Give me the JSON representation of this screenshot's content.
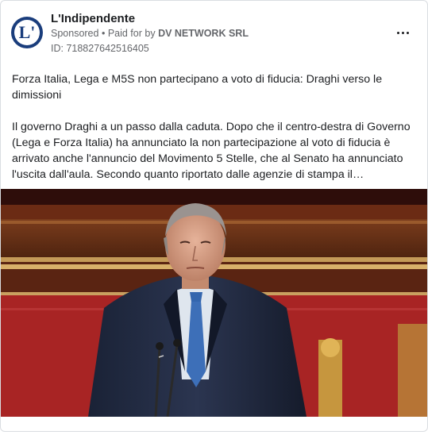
{
  "post": {
    "page_name": "L'Indipendente",
    "avatar_letter": "L'",
    "sponsored_label": "Sponsored",
    "paid_for_prefix": "Paid for by",
    "advertiser": "DV NETWORK SRL",
    "ad_id": "ID: 718827642516405",
    "headline": "Forza Italia, Lega e M5S non partecipano a voto di fiducia: Draghi verso le dimissioni",
    "body": "Il governo Draghi a un passo dalla caduta. Dopo che il centro-destra di Governo (Lega e Forza Italia) ha annunciato la non partecipazione al voto di fiducia è arrivato anche l'annuncio del Movimento 5 Stelle, che al Senato ha annunciato l'uscita dall'aula. Secondo quanto riportato dalle agenzie di stampa il presidente…",
    "more_icon": "more-horizontal-icon"
  },
  "colors": {
    "text": "#1c1e21",
    "secondary": "#65676b",
    "avatar_bg": "#1a3d7c",
    "photo_wall": "#8a1f1f"
  }
}
